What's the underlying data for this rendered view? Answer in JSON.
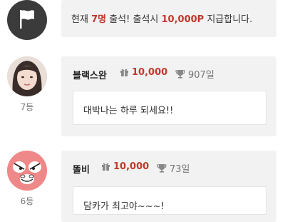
{
  "notice": {
    "prefix": "현재 ",
    "count": "7명",
    "middle": " 출석! 출석시 ",
    "points": "10,000P",
    "suffix": " 지급합니다."
  },
  "entries": [
    {
      "name": "블랙스완",
      "points": "10,000",
      "days": "907일",
      "message": "대박나는 하루 되세요!!",
      "rank": "7등"
    },
    {
      "name": "똘비",
      "points": "10,000",
      "days": "73일",
      "message": "담카가 최고야~~~!",
      "rank": "6등"
    }
  ],
  "colors": {
    "accent": "#c0392b",
    "card": "#f2f2f2",
    "icon_dark": "#3b3b3b"
  },
  "icons": [
    "flag-icon",
    "gift-icon",
    "trophy-icon"
  ]
}
